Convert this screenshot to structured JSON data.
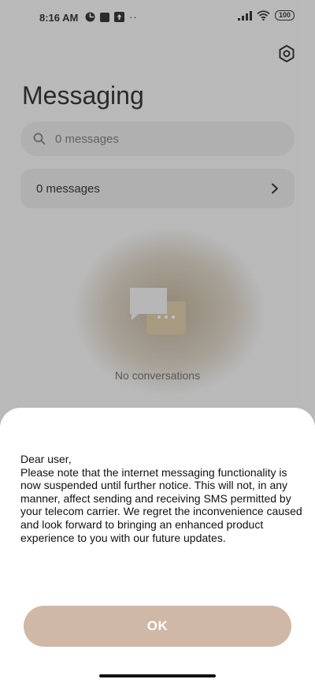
{
  "status_bar": {
    "time": "8:16 AM",
    "battery": "100",
    "dots": "··"
  },
  "header": {
    "title": "Messaging"
  },
  "search": {
    "placeholder": "0 messages"
  },
  "messages_row": {
    "label": "0 messages"
  },
  "empty_state": {
    "text": "No conversations"
  },
  "dialog": {
    "greeting": "Dear user,",
    "body": "Please note that the internet messaging functionality is now suspended until further notice. This will not, in any manner, affect sending and receiving SMS permitted by your telecom carrier. We regret the inconvenience caused and look forward to bringing an enhanced product experience to you with our future updates.",
    "ok_label": "OK"
  },
  "colors": {
    "ok_button": "#cfb8a6",
    "accent_blob": "#8c6e3c"
  }
}
